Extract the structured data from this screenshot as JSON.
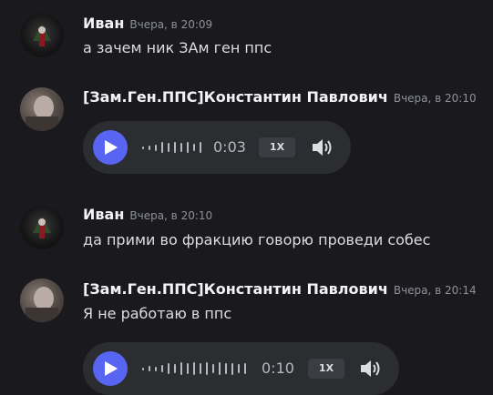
{
  "messages": [
    {
      "author": "Иван",
      "time": "Вчера, в 20:09",
      "text": "а зачем ник ЗАм ген ппс"
    },
    {
      "author": "[Зам.Ген.ППС]Константин Павлович",
      "time": "Вчера, в 20:10",
      "voice": {
        "duration": "0:03",
        "speed": "1X"
      }
    },
    {
      "author": "Иван",
      "time": "Вчера, в 20:10",
      "text": "да прими во фракцию говорю проведи собес"
    },
    {
      "author": "[Зам.Ген.ППС]Константин Павлович",
      "time": "Вчера, в 20:14",
      "text": "Я не работаю в ппс",
      "voice": {
        "duration": "0:10",
        "speed": "1X"
      }
    }
  ],
  "colors": {
    "background": "#1a1a1e",
    "accent": "#5865f2",
    "voice_bg": "#2b2d31"
  }
}
